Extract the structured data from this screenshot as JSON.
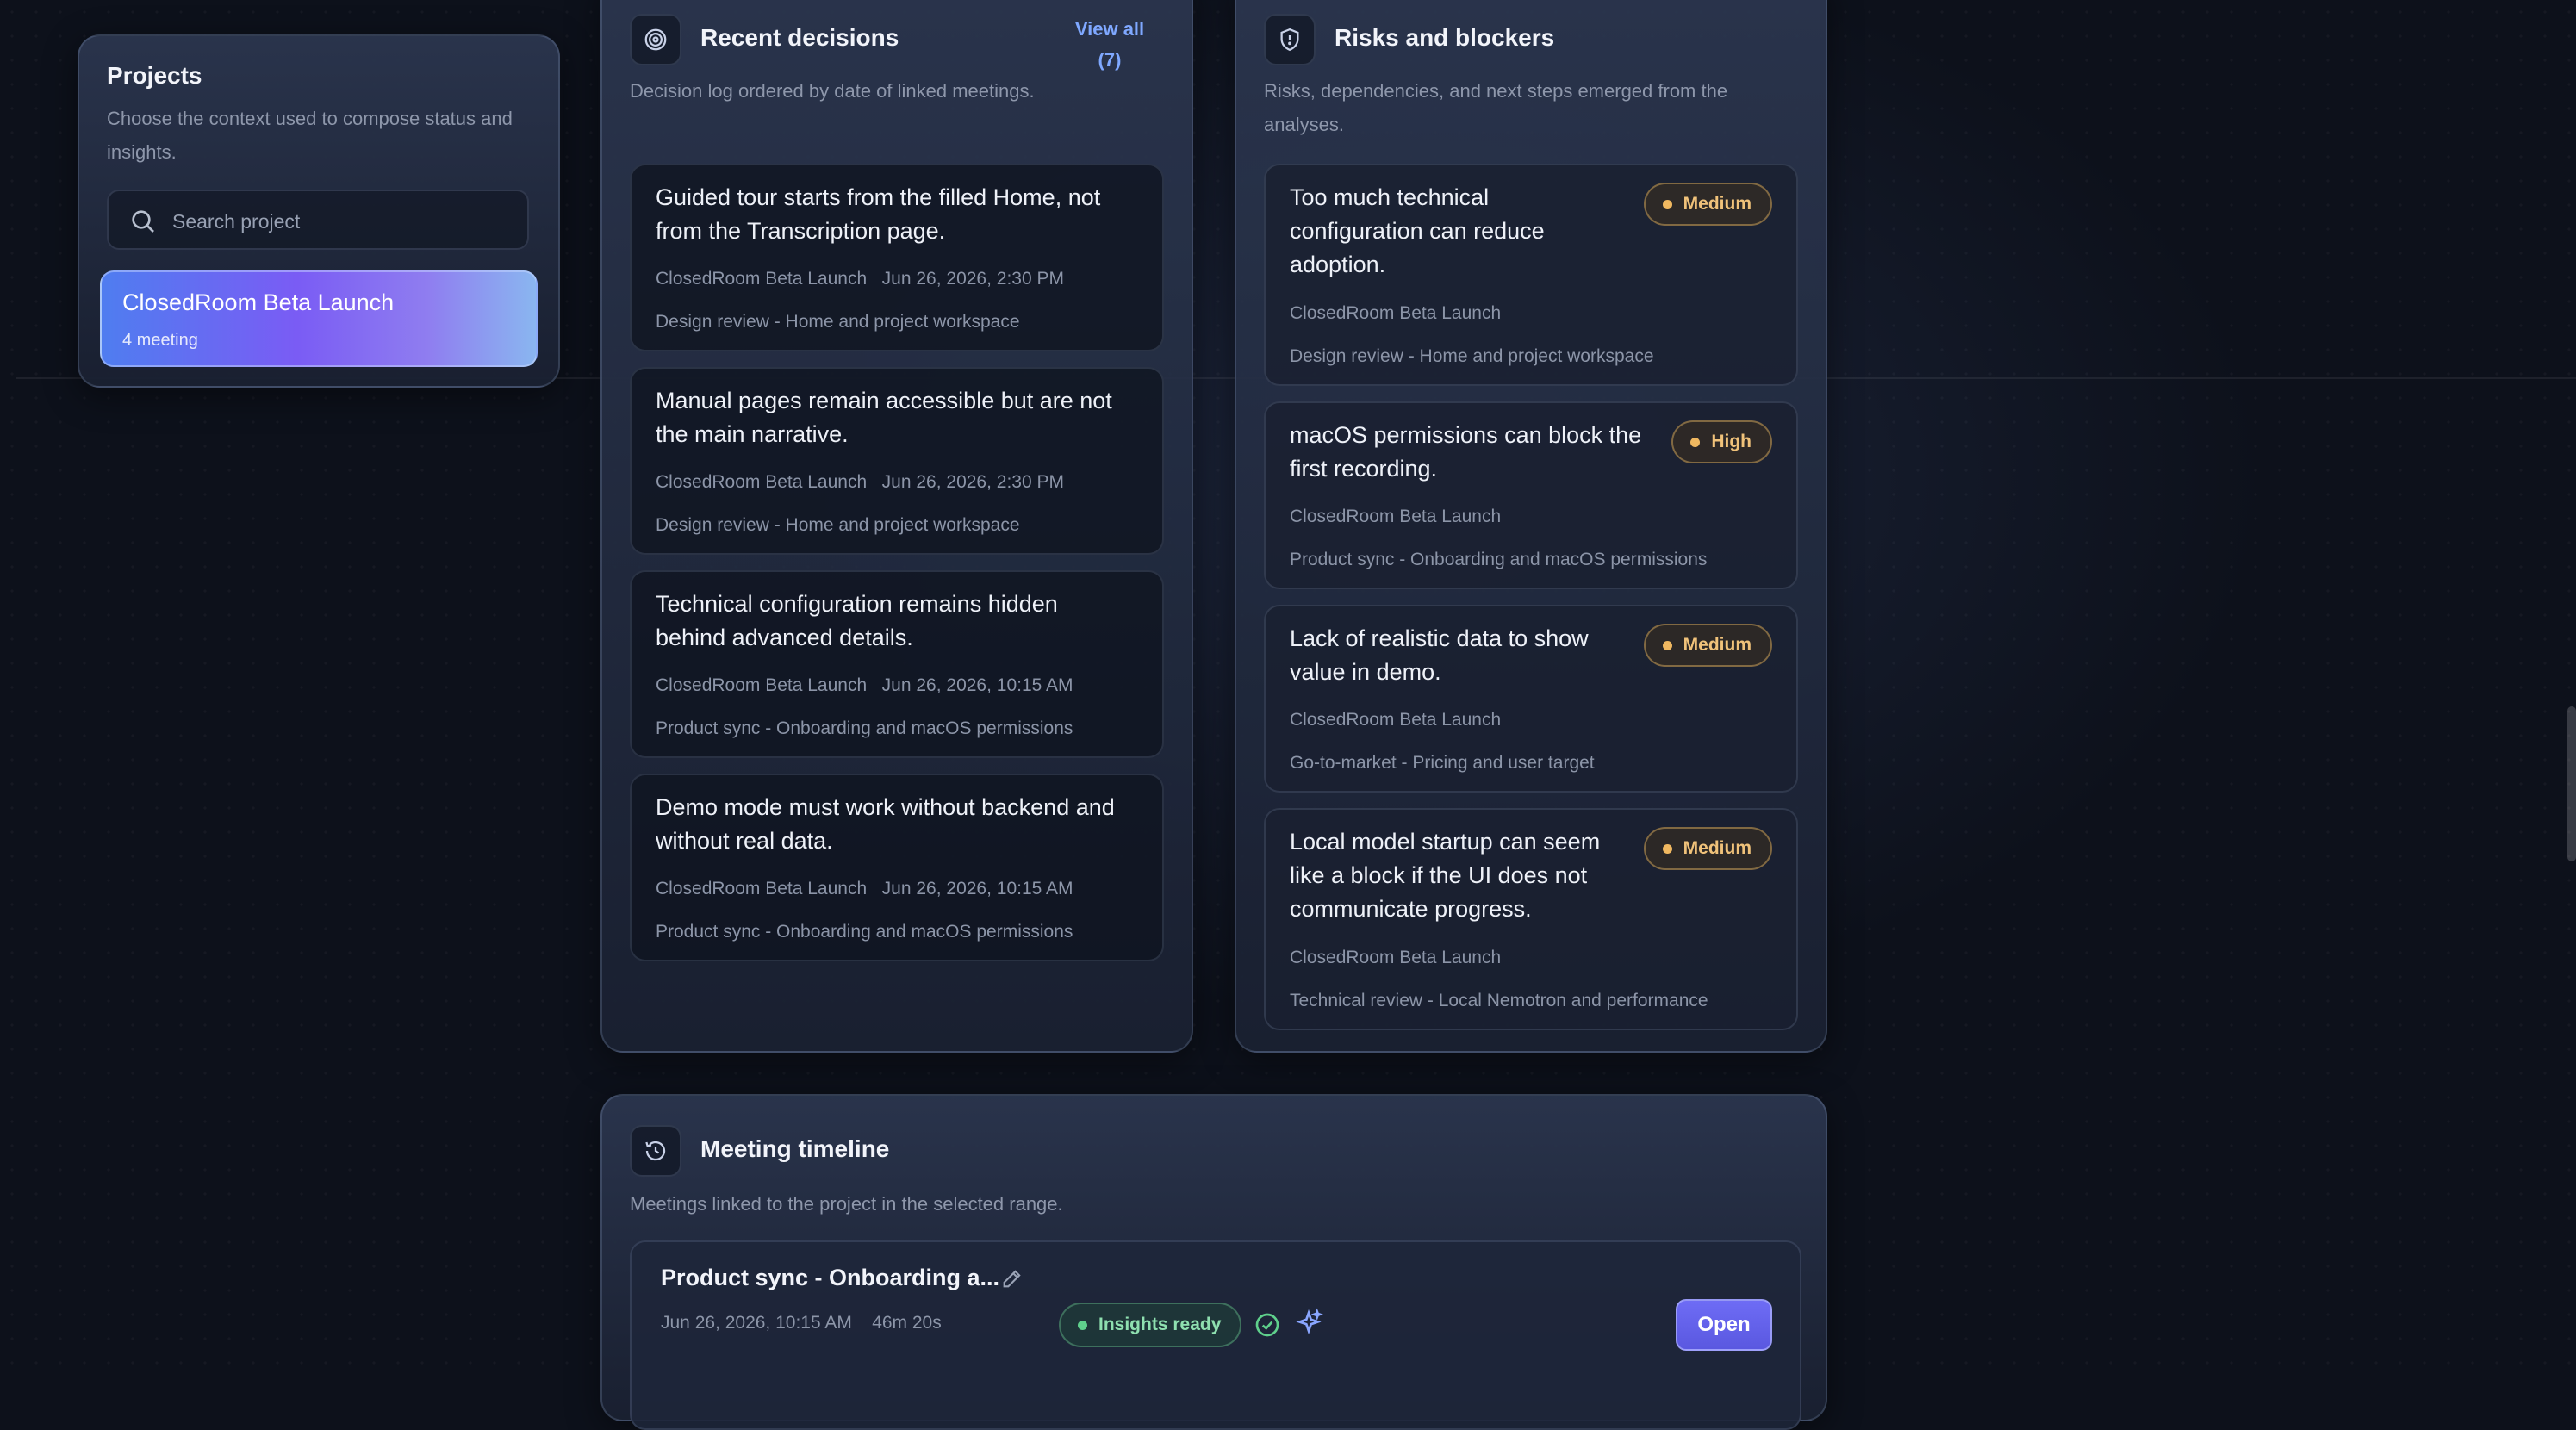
{
  "projects": {
    "title": "Projects",
    "subtitle": "Choose the context used to compose status and insights.",
    "search_placeholder": "Search project",
    "selected": {
      "name": "ClosedRoom Beta Launch",
      "meta": "4 meeting"
    }
  },
  "decisions": {
    "title": "Recent decisions",
    "subtitle": "Decision log ordered by date of linked meetings.",
    "view_all_line1": "View all",
    "view_all_line2": "(7)",
    "items": [
      {
        "title": "Guided tour starts from the filled Home, not from the Transcription page.",
        "project": "ClosedRoom Beta Launch",
        "date": "Jun 26, 2026, 2:30 PM",
        "meeting": "Design review - Home and project workspace"
      },
      {
        "title": "Manual pages remain accessible but are not the main narrative.",
        "project": "ClosedRoom Beta Launch",
        "date": "Jun 26, 2026, 2:30 PM",
        "meeting": "Design review - Home and project workspace"
      },
      {
        "title": "Technical configuration remains hidden behind advanced details.",
        "project": "ClosedRoom Beta Launch",
        "date": "Jun 26, 2026, 10:15 AM",
        "meeting": "Product sync - Onboarding and macOS permissions"
      },
      {
        "title": "Demo mode must work without backend and without real data.",
        "project": "ClosedRoom Beta Launch",
        "date": "Jun 26, 2026, 10:15 AM",
        "meeting": "Product sync - Onboarding and macOS permissions"
      }
    ]
  },
  "risks": {
    "title": "Risks and blockers",
    "subtitle": "Risks, dependencies, and next steps emerged from the analyses.",
    "items": [
      {
        "title": "Too much technical configuration can reduce adoption.",
        "severity": "Medium",
        "project": "ClosedRoom Beta Launch",
        "meeting": "Design review - Home and project workspace"
      },
      {
        "title": "macOS permissions can block the first recording.",
        "severity": "High",
        "project": "ClosedRoom Beta Launch",
        "meeting": "Product sync - Onboarding and macOS permissions"
      },
      {
        "title": "Lack of realistic data to show value in demo.",
        "severity": "Medium",
        "project": "ClosedRoom Beta Launch",
        "meeting": "Go-to-market - Pricing and user target"
      },
      {
        "title": "Local model startup can seem like a block if the UI does not communicate progress.",
        "severity": "Medium",
        "project": "ClosedRoom Beta Launch",
        "meeting": "Technical review - Local Nemotron and performance"
      }
    ]
  },
  "timeline": {
    "title": "Meeting timeline",
    "subtitle": "Meetings linked to the project in the selected range.",
    "meeting": {
      "title": "Product sync - Onboarding a...",
      "date": "Jun 26, 2026, 10:15 AM",
      "duration": "46m 20s",
      "status": "Insights ready",
      "open_label": "Open"
    }
  },
  "colors": {
    "accent": "#6e6cf5",
    "medium": "#f0c27a",
    "ready": "#5fd08c",
    "link": "#7fa8ff"
  }
}
